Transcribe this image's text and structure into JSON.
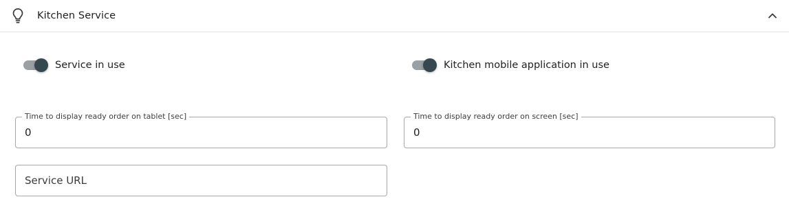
{
  "header": {
    "title": "Kitchen Service",
    "icon": "lightbulb-icon",
    "collapse_icon": "chevron-up-icon"
  },
  "toggles": [
    {
      "label": "Service in use",
      "checked": true
    },
    {
      "label": "Kitchen mobile application in use",
      "checked": true
    }
  ],
  "fields": {
    "tablet_time": {
      "label": "Time to display ready order on tablet [sec]",
      "value": "0"
    },
    "screen_time": {
      "label": "Time to display ready order on screen [sec]",
      "value": "0"
    },
    "service_url": {
      "placeholder": "Service URL",
      "value": ""
    }
  },
  "colors": {
    "switch_thumb": "#37474f",
    "switch_track": "#9aa0a4",
    "border": "#a8a8a8",
    "divider": "#e4e4e4"
  }
}
